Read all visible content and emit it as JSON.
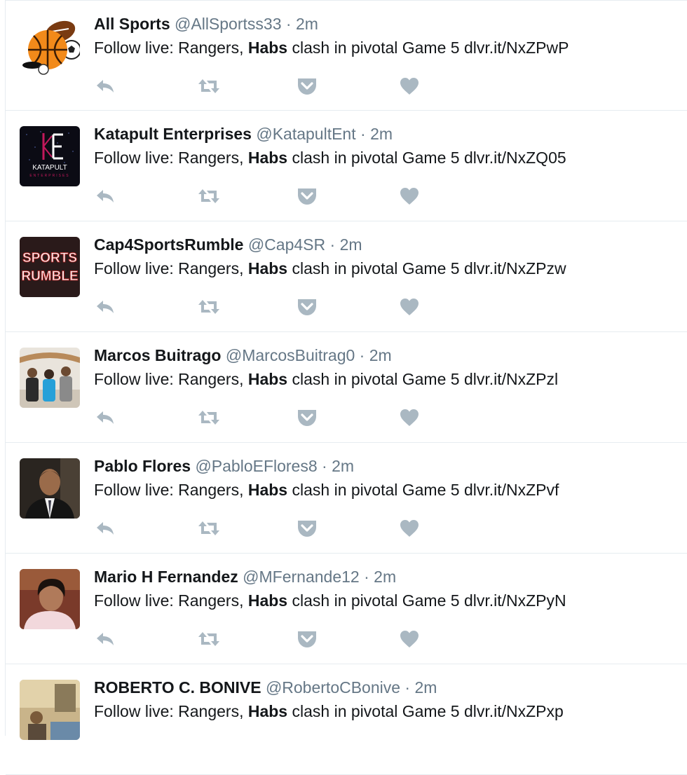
{
  "colors": {
    "name": "#14171a",
    "secondary": "#657786",
    "action_icon": "#aab8c2",
    "divider": "#e6ecf0"
  },
  "icons": {
    "reply": "reply-icon",
    "retweet": "retweet-icon",
    "pocket": "pocket-save-icon",
    "like": "heart-icon"
  },
  "tweets": [
    {
      "fullname": "All Sports",
      "username": "@AllSportss33",
      "separator": " · ",
      "time": "2m",
      "text_before": "Follow live: Rangers, ",
      "text_bold": "Habs",
      "text_after": " clash in pivotal Game 5 dlvr.it/NxZPwP"
    },
    {
      "fullname": "Katapult Enterprises",
      "username": "@KatapultEnt",
      "separator": " · ",
      "time": "2m",
      "text_before": "Follow live: Rangers, ",
      "text_bold": "Habs",
      "text_after": " clash in pivotal Game 5 dlvr.it/NxZQ05"
    },
    {
      "fullname": "Cap4SportsRumble",
      "username": "@Cap4SR",
      "separator": " · ",
      "time": "2m",
      "text_before": "Follow live: Rangers, ",
      "text_bold": "Habs",
      "text_after": " clash in pivotal Game 5 dlvr.it/NxZPzw"
    },
    {
      "fullname": "Marcos Buitrago",
      "username": "@MarcosBuitrag0",
      "separator": " · ",
      "time": "2m",
      "text_before": "Follow live: Rangers, ",
      "text_bold": "Habs",
      "text_after": " clash in pivotal Game 5 dlvr.it/NxZPzl"
    },
    {
      "fullname": "Pablo Flores",
      "username": "@PabloEFlores8",
      "separator": " · ",
      "time": "2m",
      "text_before": "Follow live: Rangers, ",
      "text_bold": "Habs",
      "text_after": " clash in pivotal Game 5 dlvr.it/NxZPvf"
    },
    {
      "fullname": "Mario H Fernandez",
      "username": "@MFernande12",
      "separator": " · ",
      "time": "2m",
      "text_before": "Follow live: Rangers, ",
      "text_bold": "Habs",
      "text_after": " clash in pivotal Game 5 dlvr.it/NxZPyN"
    },
    {
      "fullname": "ROBERTO C. BONIVE",
      "username": "@RobertoCBonive",
      "separator": " · ",
      "time": "2m",
      "text_before": "Follow live: Rangers, ",
      "text_bold": "Habs",
      "text_after": " clash in pivotal Game 5 dlvr.it/NxZPxp"
    }
  ],
  "avatar_logos": {
    "katapult": "KATAPULT",
    "katapult_sub": "ENTERPRISES",
    "sports_rumble_1": "SPORTS",
    "sports_rumble_2": "RUMBLE"
  }
}
